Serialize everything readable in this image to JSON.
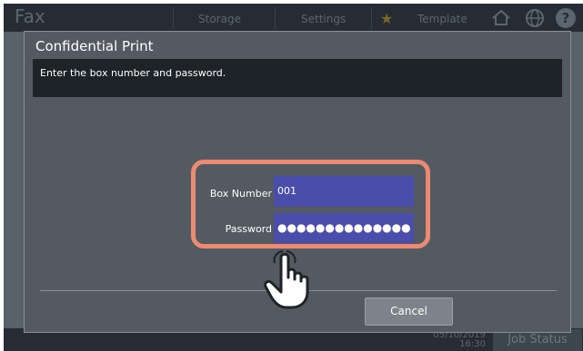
{
  "app": {
    "title": "Fax",
    "nav": [
      "Storage",
      "Settings",
      "Template"
    ],
    "datetime_line1": "05/10/2019",
    "datetime_line2": "16:30",
    "job_status": "Job Status"
  },
  "dialog": {
    "title": "Confidential Print",
    "instruction": "Enter the box number and password.",
    "box_number_label": "Box Number",
    "box_number_value": "001",
    "password_label": "Password",
    "password_value": "●●●●●●●●●●●●●●",
    "cancel_label": "Cancel"
  },
  "colors": {
    "highlight": "#ec8a72",
    "field_fill": "#4b4dab"
  },
  "icons": [
    "star-icon",
    "home-icon",
    "globe-icon",
    "help-icon",
    "hand-pointer-icon"
  ]
}
